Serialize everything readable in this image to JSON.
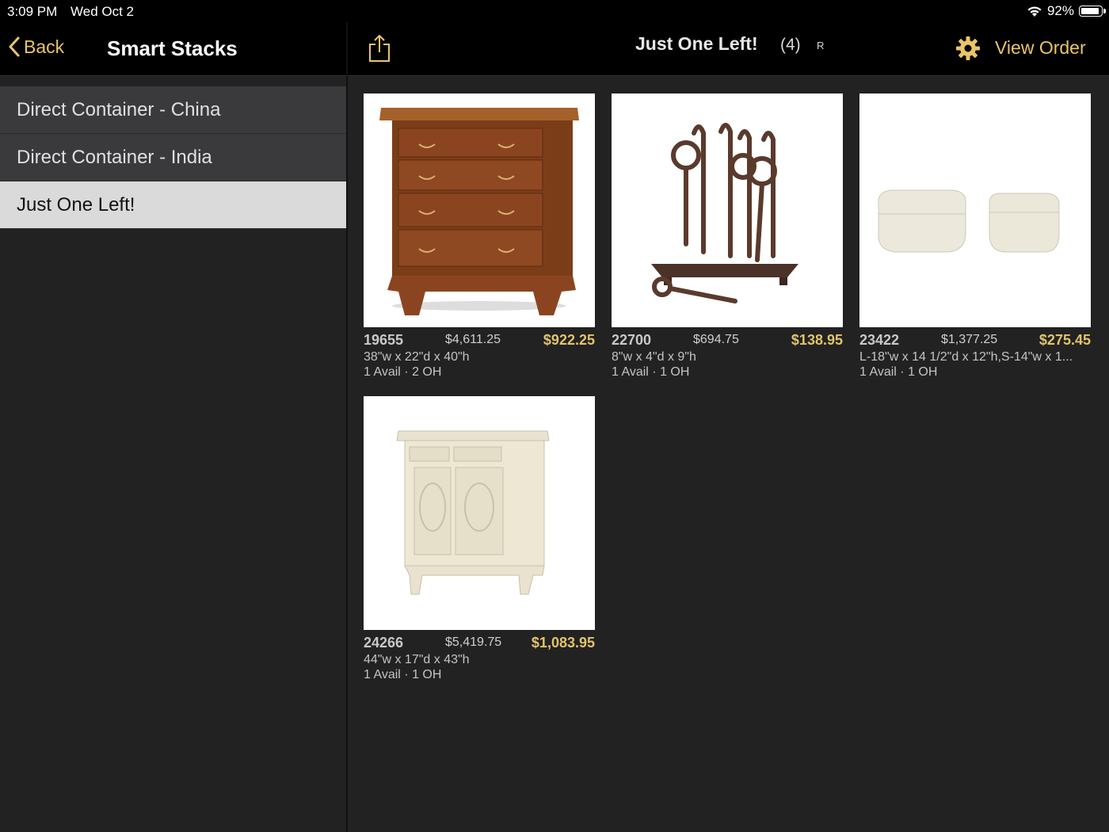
{
  "status_bar": {
    "time": "3:09 PM",
    "date": "Wed Oct 2",
    "battery": "92%",
    "battery_level": 0.92
  },
  "left_nav": {
    "back_label": "Back",
    "title": "Smart Stacks"
  },
  "sidebar": {
    "items": [
      {
        "label": "Direct Container - China",
        "selected": false
      },
      {
        "label": "Direct Container - India",
        "selected": false
      },
      {
        "label": "Just One Left!",
        "selected": true
      }
    ]
  },
  "right_nav": {
    "title": "Just One Left!",
    "count": "(4)",
    "mark": "R",
    "view_order_label": "View Order"
  },
  "products": [
    {
      "sku": "19655",
      "retail": "$4,611.25",
      "price": "$922.25",
      "dims": "38\"w x 22\"d x 40\"h",
      "avail": "1 Avail · 2 OH",
      "image": "chest-of-drawers"
    },
    {
      "sku": "22700",
      "retail": "$694.75",
      "price": "$138.95",
      "dims": "8\"w x 4\"d x 9\"h",
      "avail": "1 Avail · 1 OH",
      "image": "iron-keys-stand"
    },
    {
      "sku": "23422",
      "retail": "$1,377.25",
      "price": "$275.45",
      "dims": "L-18\"w x 14 1/2\"d x 12\"h,S-14\"w x 1...",
      "avail": "1 Avail · 1 OH",
      "image": "white-boxes"
    },
    {
      "sku": "24266",
      "retail": "$5,419.75",
      "price": "$1,083.95",
      "dims": "44\"w x 17\"d x 43\"h",
      "avail": "1 Avail · 1 OH",
      "image": "cream-cabinet"
    }
  ],
  "colors": {
    "accent": "#e9c56a",
    "price": "#e2c46a",
    "background": "#222223",
    "sidebar_item": "#3a3a3c",
    "sidebar_selected": "#dadada"
  }
}
